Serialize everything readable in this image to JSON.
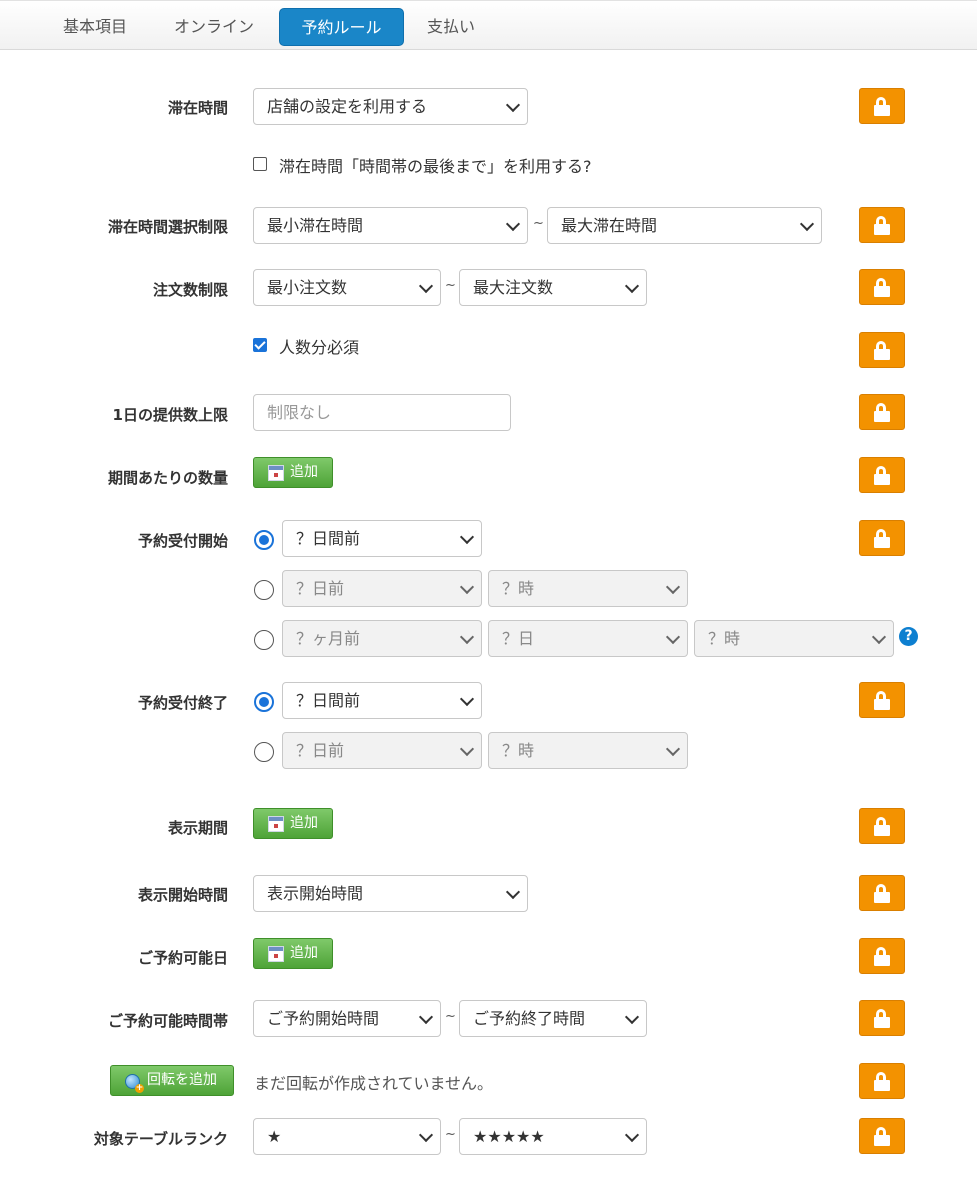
{
  "tabs": [
    {
      "label": "基本項目",
      "active": false
    },
    {
      "label": "オンライン",
      "active": false
    },
    {
      "label": "予約ルール",
      "active": true
    },
    {
      "label": "支払い",
      "active": false
    }
  ],
  "form": {
    "stay_time": {
      "label": "滞在時間",
      "value": "店舗の設定を利用する"
    },
    "stay_until_end": {
      "label": "滞在時間「時間帯の最後まで」を利用する?",
      "checked": false
    },
    "stay_limit": {
      "label": "滞在時間選択制限",
      "min": "最小滞在時間",
      "max": "最大滞在時間",
      "sep": "~"
    },
    "order_limit": {
      "label": "注文数制限",
      "min": "最小注文数",
      "max": "最大注文数",
      "sep": "~"
    },
    "per_person_required": {
      "label": "人数分必須",
      "checked": true
    },
    "daily_limit": {
      "label": "1日の提供数上限",
      "placeholder": "制限なし"
    },
    "period_quantity": {
      "label": "期間あたりの数量",
      "button": "追加"
    },
    "reservation_start": {
      "label": "予約受付開始",
      "options": [
        {
          "selected": true,
          "fields": [
            "？日間前"
          ]
        },
        {
          "selected": false,
          "fields": [
            "？日前",
            "？時"
          ]
        },
        {
          "selected": false,
          "fields": [
            "？ヶ月前",
            "？日",
            "？時"
          ]
        }
      ],
      "help_icon": "question-circle-icon"
    },
    "reservation_end": {
      "label": "予約受付終了",
      "options": [
        {
          "selected": true,
          "fields": [
            "？日間前"
          ]
        },
        {
          "selected": false,
          "fields": [
            "？日前",
            "？時"
          ]
        }
      ]
    },
    "display_period": {
      "label": "表示期間",
      "button": "追加"
    },
    "display_start_time": {
      "label": "表示開始時間",
      "value": "表示開始時間"
    },
    "reservable_days": {
      "label": "ご予約可能日",
      "button": "追加"
    },
    "reservable_time": {
      "label": "ご予約可能時間帯",
      "start": "ご予約開始時間",
      "end": "ご予約終了時間",
      "sep": "~"
    },
    "rotation": {
      "button": "回転を追加",
      "note": "まだ回転が作成されていません。"
    },
    "table_rank": {
      "label": "対象テーブルランク",
      "min": "★",
      "max": "★★★★★",
      "sep": "~"
    }
  },
  "colors": {
    "accent": "#1a86c8",
    "lock": "#f39200",
    "add_button": "#4ea337",
    "radio": "#1a73d9"
  },
  "icons": {
    "lock": "lock-icon",
    "calendar": "calendar-icon",
    "globe_add": "globe-add-icon"
  }
}
